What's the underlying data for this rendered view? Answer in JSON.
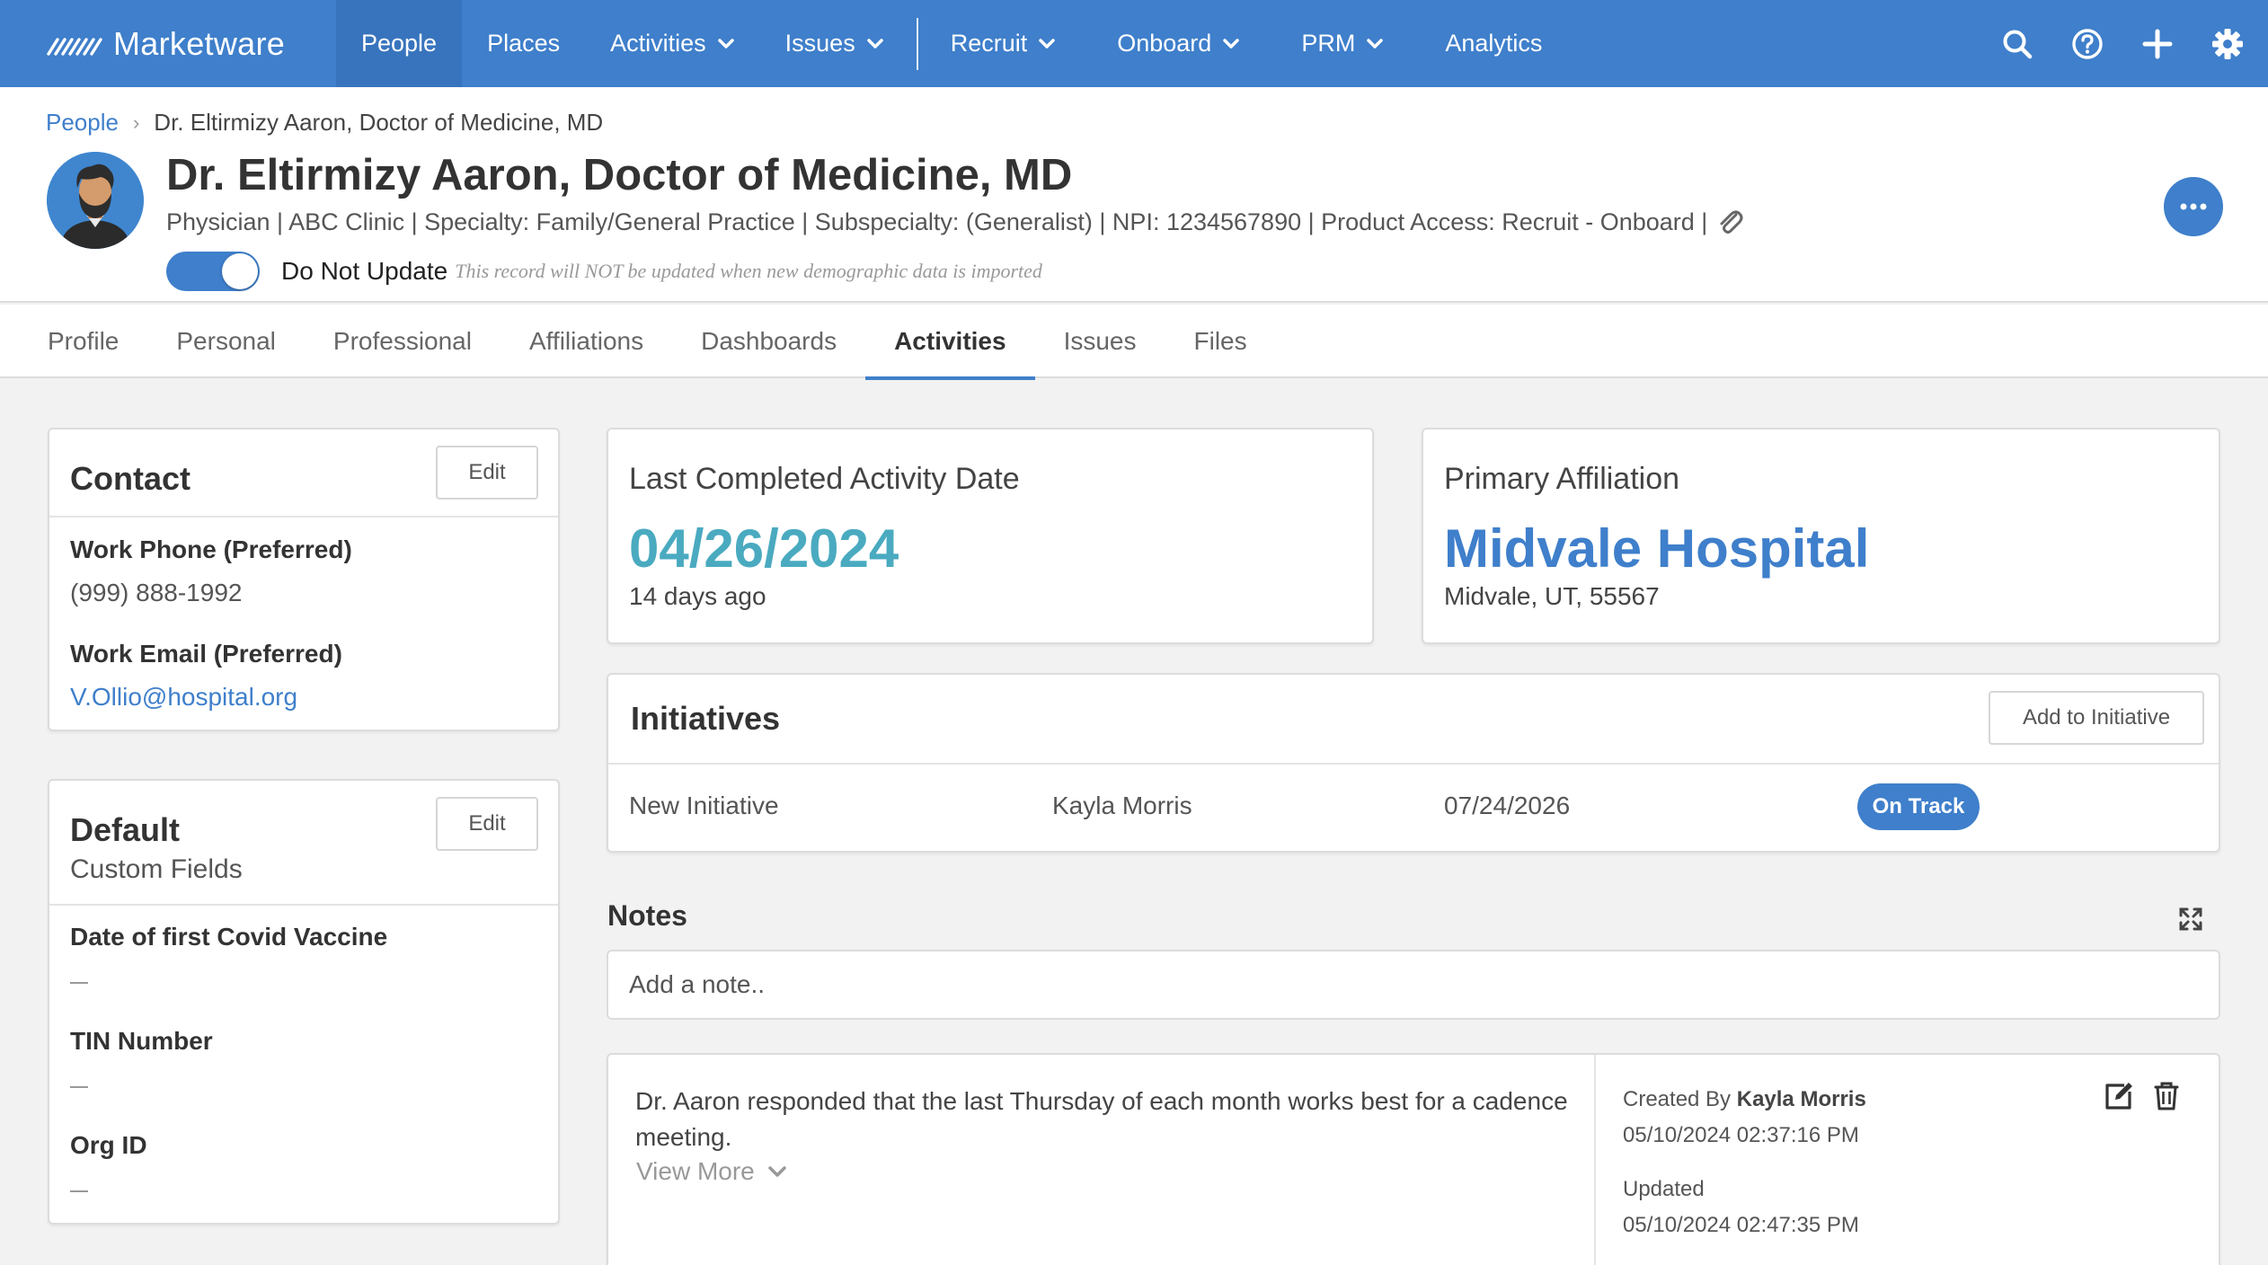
{
  "brand": {
    "name": "Marketware"
  },
  "nav": {
    "items": [
      {
        "label": "People",
        "active": true,
        "dropdown": false
      },
      {
        "label": "Places",
        "active": false,
        "dropdown": false
      },
      {
        "label": "Activities",
        "active": false,
        "dropdown": true
      },
      {
        "label": "Issues",
        "active": false,
        "dropdown": true
      },
      {
        "label": "Recruit",
        "active": false,
        "dropdown": true
      },
      {
        "label": "Onboard",
        "active": false,
        "dropdown": true
      },
      {
        "label": "PRM",
        "active": false,
        "dropdown": true
      },
      {
        "label": "Analytics",
        "active": false,
        "dropdown": false
      }
    ],
    "tools": [
      "search-icon",
      "help-icon",
      "plus-icon",
      "gear-icon"
    ]
  },
  "breadcrumb": {
    "root": "People",
    "current": "Dr. Eltirmizy Aaron, Doctor of Medicine, MD"
  },
  "person": {
    "name": "Dr. Eltirmizy Aaron, Doctor of Medicine, MD",
    "subtitle": "Physician | ABC Clinic | Specialty: Family/General Practice | Subspecialty: (Generalist) | NPI: 1234567890 | Product Access: Recruit - Onboard |",
    "do_not_update_label": "Do Not Update",
    "do_not_update_note": "This record will NOT be updated when new demographic data is imported",
    "do_not_update_on": true
  },
  "tabs": [
    {
      "label": "Profile",
      "active": false
    },
    {
      "label": "Personal",
      "active": false
    },
    {
      "label": "Professional",
      "active": false
    },
    {
      "label": "Affiliations",
      "active": false
    },
    {
      "label": "Dashboards",
      "active": false
    },
    {
      "label": "Activities",
      "active": true
    },
    {
      "label": "Issues",
      "active": false
    },
    {
      "label": "Files",
      "active": false
    }
  ],
  "contact": {
    "title": "Contact",
    "edit_label": "Edit",
    "phone_label": "Work Phone (Preferred)",
    "phone_value": "(999) 888-1992",
    "email_label": "Work Email (Preferred)",
    "email_value": "V.Ollio@hospital.org"
  },
  "default_fields": {
    "title": "Default",
    "subtitle": "Custom Fields",
    "edit_label": "Edit",
    "fields": [
      {
        "label": "Date of first Covid Vaccine",
        "value": "—"
      },
      {
        "label": "TIN Number",
        "value": "—"
      },
      {
        "label": "Org ID",
        "value": "—"
      }
    ]
  },
  "last_activity": {
    "label": "Last Completed Activity Date",
    "date": "04/26/2024",
    "ago": "14 days ago",
    "color": "#4aaac0"
  },
  "primary_affiliation": {
    "label": "Primary Affiliation",
    "name": "Midvale Hospital",
    "location": "Midvale, UT, 55567",
    "color": "#3f7fcb"
  },
  "initiatives": {
    "title": "Initiatives",
    "add_label": "Add to Initiative",
    "rows": [
      {
        "name": "New Initiative",
        "owner": "Kayla Morris",
        "date": "07/24/2026",
        "status": "On Track"
      }
    ]
  },
  "notes": {
    "title": "Notes",
    "placeholder": "Add a note..",
    "items": [
      {
        "text": "Dr. Aaron responded that the last Thursday of each month works best for a cadence meeting.",
        "view_more": "View More",
        "created_by_label": "Created By",
        "created_by": "Kayla Morris",
        "created_at": "05/10/2024 02:37:16 PM",
        "updated_label": "Updated",
        "updated_at": "05/10/2024 02:47:35 PM"
      }
    ]
  },
  "colors": {
    "primary": "#3f7fcb",
    "teal": "#4aaac0"
  }
}
